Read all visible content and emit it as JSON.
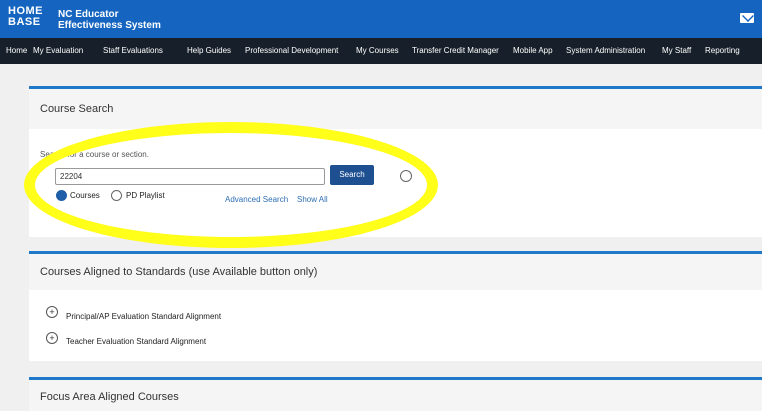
{
  "brand": {
    "logo_line1": "HOME",
    "logo_line2": "BASE",
    "title_line1": "NC Educator",
    "title_line2": "Effectiveness System"
  },
  "nav": [
    "Home",
    "My Evaluation",
    "Staff Evaluations",
    "Help Guides",
    "Professional Development",
    "My Courses",
    "Transfer Credit Manager",
    "Mobile App",
    "System Administration",
    "My Staff",
    "Reporting"
  ],
  "course_search": {
    "title": "Course Search",
    "prompt": "Search for a course or section.",
    "query": "22204",
    "search_label": "Search",
    "radio_courses": "Courses",
    "radio_playlist": "PD Playlist",
    "advanced": "Advanced Search",
    "show_all": "Show All"
  },
  "aligned": {
    "title": "Courses Aligned to Standards (use Available button only)",
    "items": [
      "Principal/AP Evaluation Standard Alignment",
      "Teacher Evaluation Standard Alignment"
    ]
  },
  "focus": {
    "title": "Focus Area Aligned Courses"
  },
  "colors": {
    "topbar": "#1565c0",
    "navbar": "#17202a",
    "highlight": "#ffff1a",
    "accent": "#1f78c8"
  }
}
